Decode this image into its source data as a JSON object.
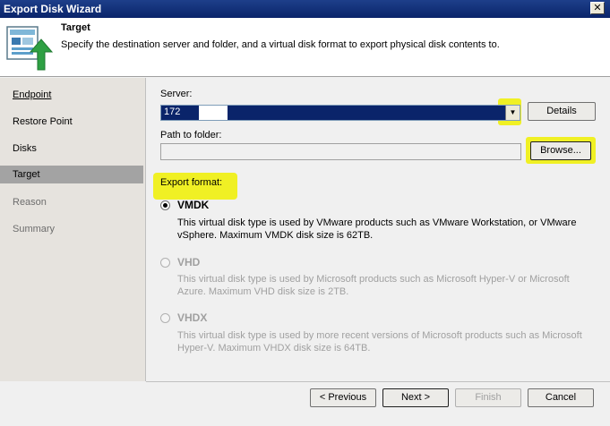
{
  "window": {
    "title": "Export Disk Wizard",
    "close_glyph": "✕"
  },
  "header": {
    "title": "Target",
    "description": "Specify the destination server and folder, and a virtual disk format to export physical disk contents to.",
    "icon": "disk-export-icon"
  },
  "sidebar": {
    "items": [
      {
        "label": "Endpoint",
        "state": "link"
      },
      {
        "label": "Restore Point",
        "state": "normal"
      },
      {
        "label": "Disks",
        "state": "normal"
      },
      {
        "label": "Target",
        "state": "active"
      },
      {
        "label": "Reason",
        "state": "disabled"
      },
      {
        "label": "Summary",
        "state": "disabled"
      }
    ]
  },
  "form": {
    "server_label": "Server:",
    "server_value": "172",
    "details_label": "Details",
    "path_label": "Path to folder:",
    "path_value": "",
    "browse_label": "Browse...",
    "export_format_label": "Export format:",
    "formats": [
      {
        "name": "VMDK",
        "checked": true,
        "enabled": true,
        "description": "This virtual disk type is used by VMware products such as VMware Workstation, or VMware vSphere. Maximum VMDK disk size is 62TB."
      },
      {
        "name": "VHD",
        "checked": false,
        "enabled": false,
        "description": "This virtual disk type is used by Microsoft products such as Microsoft Hyper-V or Microsoft Azure. Maximum VHD disk size is 2TB."
      },
      {
        "name": "VHDX",
        "checked": false,
        "enabled": false,
        "description": "This virtual disk type is used by more recent versions of Microsoft products such as Microsoft Hyper-V. Maximum VHDX disk size is 64TB."
      }
    ]
  },
  "footer": {
    "previous_label": "< Previous",
    "next_label": "Next >",
    "finish_label": "Finish",
    "cancel_label": "Cancel"
  },
  "colors": {
    "highlight": "#f0f000",
    "selection": "#0a246a",
    "icon_arrow": "#2ea043"
  }
}
